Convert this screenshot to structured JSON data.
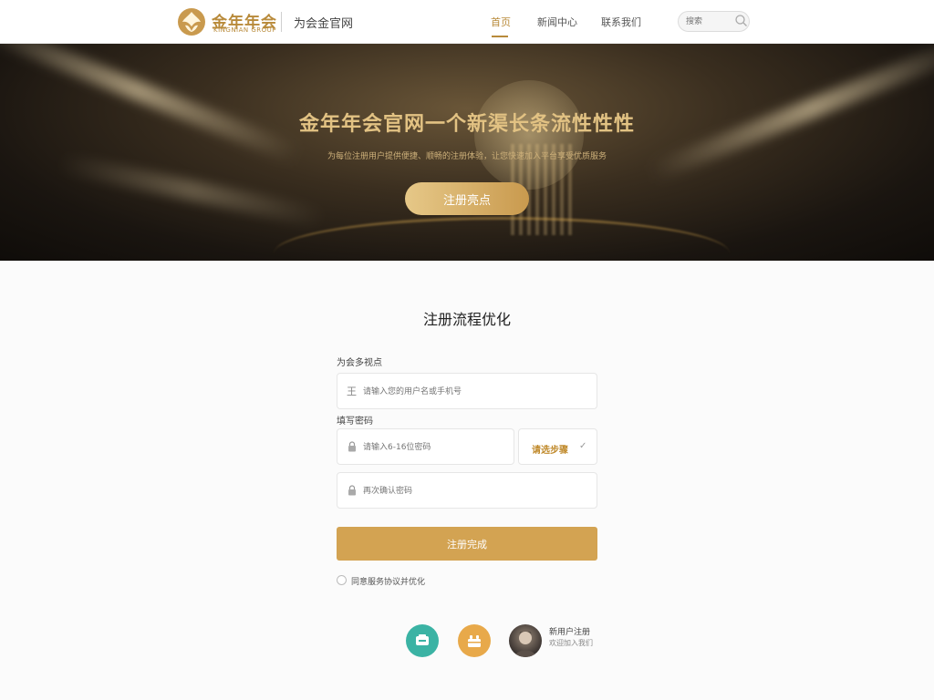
{
  "header": {
    "logo_title": "金年年会",
    "logo_sub": "KINGNIAN  GROUP",
    "site_name": "为会金官网",
    "nav": [
      {
        "label": "首页",
        "active": true
      },
      {
        "label": "新闻中心",
        "active": false
      },
      {
        "label": "联系我们",
        "active": false
      }
    ],
    "search": {
      "placeholder": "搜索"
    }
  },
  "hero": {
    "title": "金年年会官网一个新渠长条流性性性",
    "subtitle": "为每位注册用户提供便捷、顺畅的注册体验，让您快速加入平台享受优质服务",
    "cta_label": "注册亮点"
  },
  "form": {
    "section_title": "注册流程优化",
    "field1_label": "为会多视点",
    "field1_placeholder": "请输入您的用户名或手机号",
    "field2_label": "填写密码",
    "field2_placeholder": "请输入6-16位密码",
    "select_label": "请选步骤",
    "field3_placeholder": "再次确认密码",
    "submit_label": "注册完成",
    "agree_label": "同意服务协议并优化"
  },
  "social": {
    "user_name": "新用户注册",
    "user_desc": "欢迎加入我们"
  },
  "colors": {
    "accent": "#d3a352",
    "gold_text": "#e2c283",
    "hero_dark": "#1a1510"
  },
  "icons": [
    "logo-icon",
    "search-icon",
    "user-icon",
    "lock-icon",
    "chevron-down-icon",
    "chat-icon",
    "gift-icon"
  ]
}
